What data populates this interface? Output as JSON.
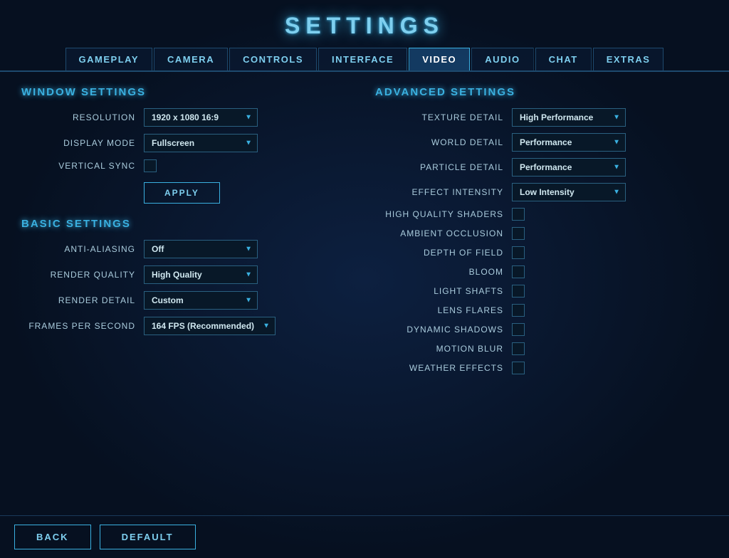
{
  "title": "SETTINGS",
  "tabs": [
    {
      "id": "gameplay",
      "label": "GAMEPLAY",
      "active": false
    },
    {
      "id": "camera",
      "label": "CAMERA",
      "active": false
    },
    {
      "id": "controls",
      "label": "CONTROLS",
      "active": false
    },
    {
      "id": "interface",
      "label": "INTERFACE",
      "active": false
    },
    {
      "id": "video",
      "label": "VIDEO",
      "active": true
    },
    {
      "id": "audio",
      "label": "AUDIO",
      "active": false
    },
    {
      "id": "chat",
      "label": "CHAT",
      "active": false
    },
    {
      "id": "extras",
      "label": "EXTRAS",
      "active": false
    }
  ],
  "window_settings": {
    "title": "WINDOW SETTINGS",
    "resolution_label": "RESOLUTION",
    "resolution_value": "1920 x 1080 16:9",
    "display_mode_label": "DISPLAY MODE",
    "display_mode_value": "Fullscreen",
    "vsync_label": "VERTICAL SYNC",
    "apply_label": "APPLY"
  },
  "basic_settings": {
    "title": "BASIC SETTINGS",
    "anti_aliasing_label": "ANTI-ALIASING",
    "anti_aliasing_value": "Off",
    "render_quality_label": "RENDER QUALITY",
    "render_quality_value": "High Quality",
    "render_detail_label": "RENDER DETAIL",
    "render_detail_value": "Custom",
    "fps_label": "FRAMES PER SECOND",
    "fps_value": "164 FPS (Recommended)"
  },
  "advanced_settings": {
    "title": "ADVANCED SETTINGS",
    "texture_detail_label": "TEXTURE DETAIL",
    "texture_detail_value": "High Performance",
    "world_detail_label": "WORLD DETAIL",
    "world_detail_value": "Performance",
    "particle_detail_label": "PARTICLE DETAIL",
    "particle_detail_value": "Performance",
    "effect_intensity_label": "EFFECT INTENSITY",
    "effect_intensity_value": "Low Intensity",
    "hq_shaders_label": "HIGH QUALITY SHADERS",
    "ambient_occlusion_label": "AMBIENT OCCLUSION",
    "depth_of_field_label": "DEPTH OF FIELD",
    "bloom_label": "BLOOM",
    "light_shafts_label": "LIGHT SHAFTS",
    "lens_flares_label": "LENS FLARES",
    "dynamic_shadows_label": "DYNAMIC SHADOWS",
    "motion_blur_label": "MOTION BLUR",
    "weather_effects_label": "WEATHER EFFECTS"
  },
  "bottom": {
    "back_label": "BACK",
    "default_label": "DEFAULT"
  }
}
